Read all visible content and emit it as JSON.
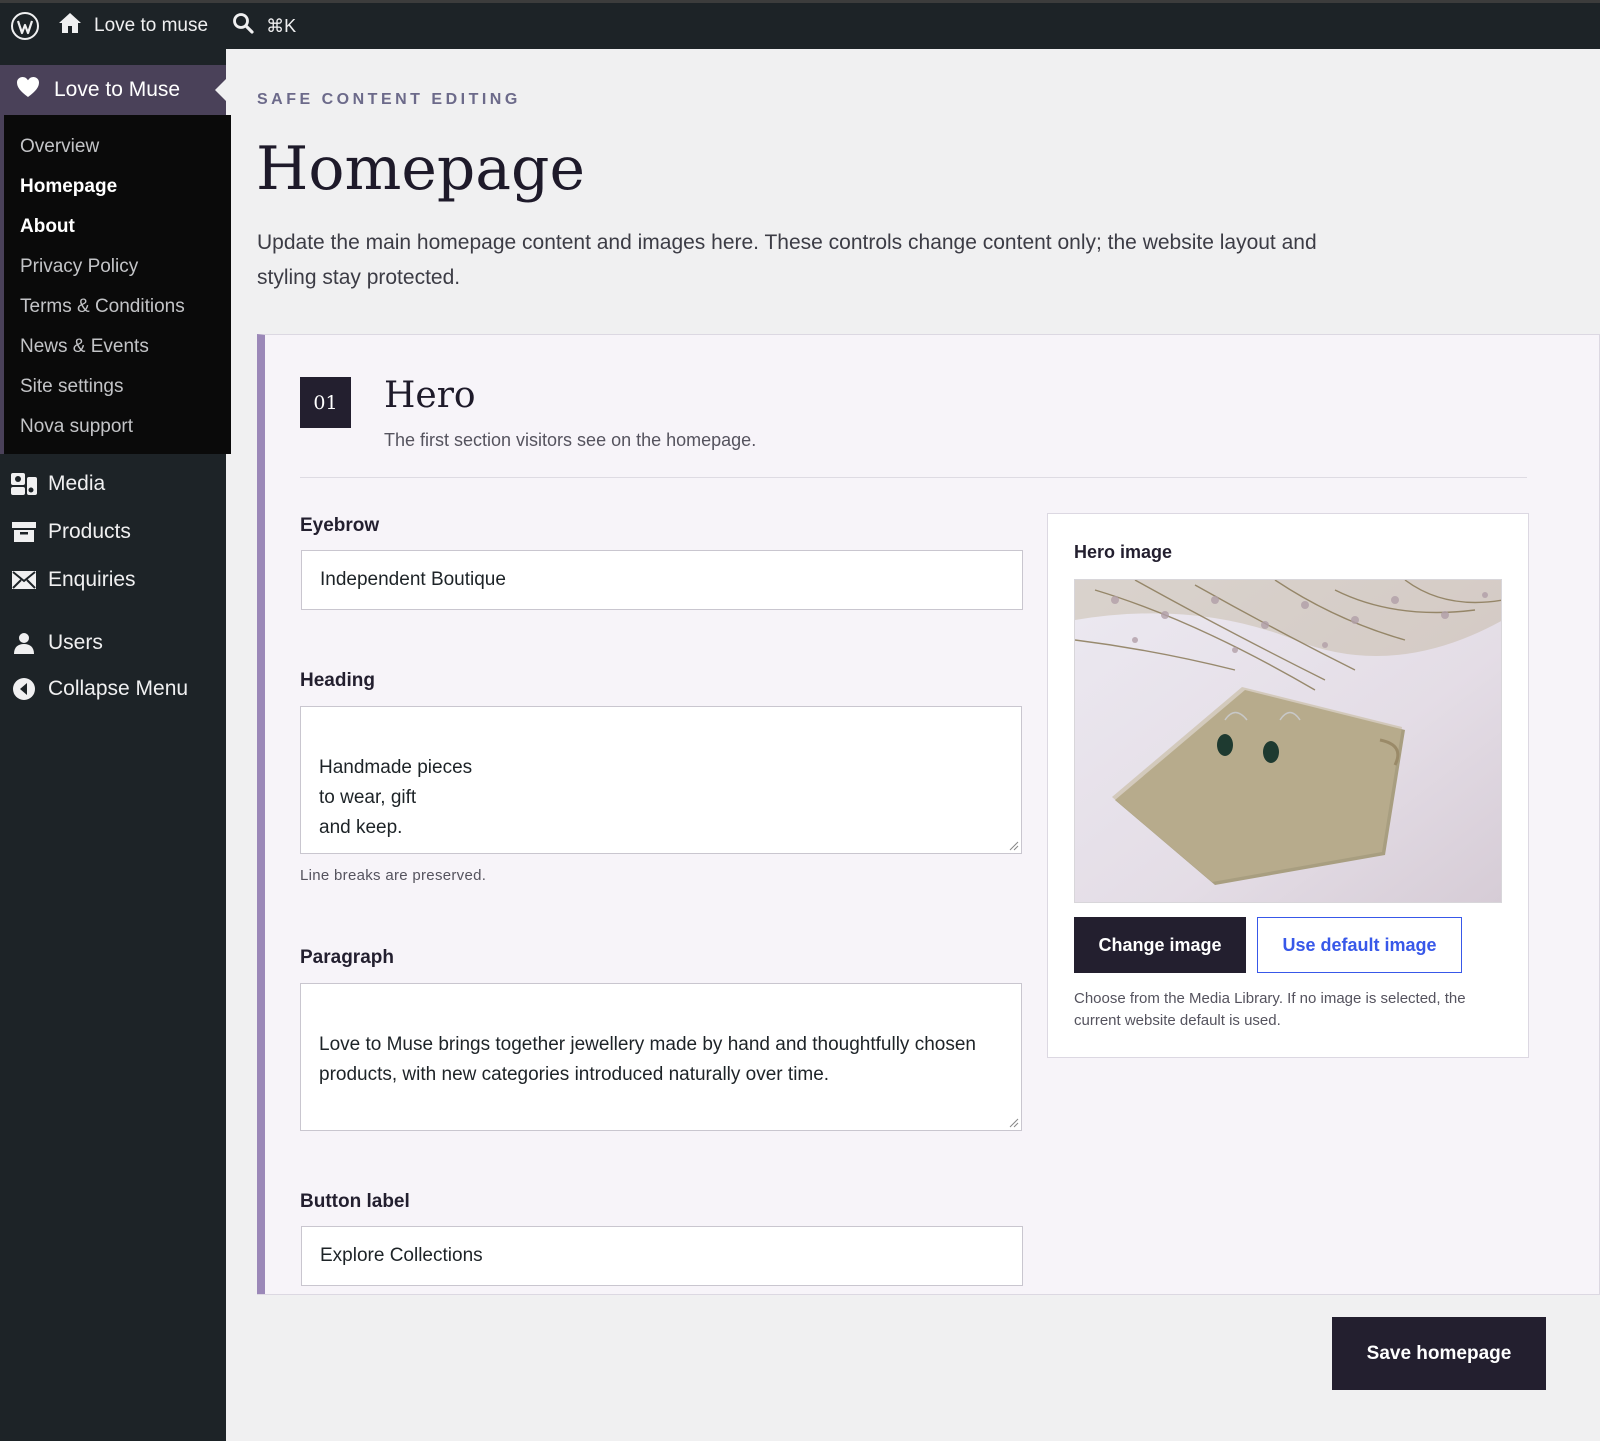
{
  "adminbar": {
    "site_name": "Love to muse",
    "search_shortcut": "⌘K"
  },
  "sidebar": {
    "active_menu": "Love to Muse",
    "submenu": [
      {
        "label": "Overview",
        "bold": false
      },
      {
        "label": "Homepage",
        "bold": true
      },
      {
        "label": "About",
        "bold": true
      },
      {
        "label": "Privacy Policy",
        "bold": false
      },
      {
        "label": "Terms & Conditions",
        "bold": false
      },
      {
        "label": "News & Events",
        "bold": false
      },
      {
        "label": "Site settings",
        "bold": false
      },
      {
        "label": "Nova support",
        "bold": false
      }
    ],
    "media": "Media",
    "products": "Products",
    "enquiries": "Enquiries",
    "users": "Users",
    "collapse": "Collapse Menu"
  },
  "page": {
    "eyebrow": "SAFE CONTENT EDITING",
    "title": "Homepage",
    "intro": "Update the main homepage content and images here. These controls change content only; the website layout and styling stay protected."
  },
  "section": {
    "number": "01",
    "title": "Hero",
    "subtitle": "The first section visitors see on the homepage.",
    "eyebrow_label": "Eyebrow",
    "eyebrow_value": "Independent Boutique",
    "heading_label": "Heading",
    "heading_value": "Handmade pieces\nto wear, gift\nand keep.",
    "heading_help": "Line breaks are preserved.",
    "paragraph_label": "Paragraph",
    "paragraph_value": "Love to Muse brings together jewellery made by hand and thoughtfully chosen products, with new categories introduced naturally over time.",
    "button_label_label": "Button label",
    "button_label_value": "Explore Collections",
    "hero_image_label": "Hero image",
    "change_image": "Change image",
    "use_default": "Use default image",
    "image_help": "Choose from the Media Library. If no image is selected, the current website default is used."
  },
  "footer": {
    "save": "Save homepage"
  },
  "colors": {
    "adminbar": "#1d2327",
    "active_menu": "#4a4159",
    "accent_border": "#9b88b8",
    "dark_button": "#231f2f",
    "link_blue": "#3858e9"
  }
}
